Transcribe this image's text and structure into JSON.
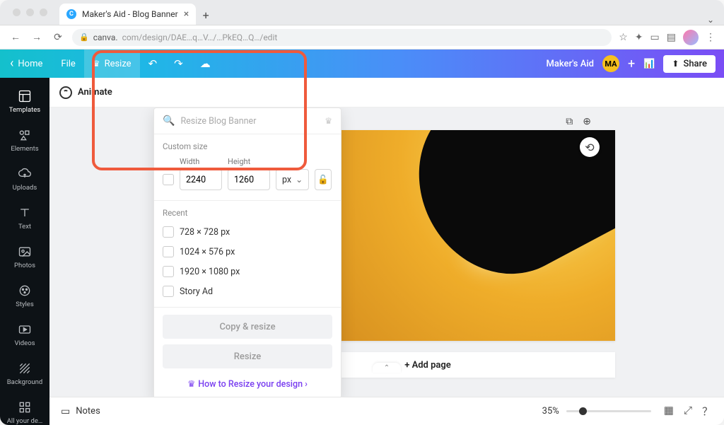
{
  "browser": {
    "tab_title": "Maker's Aid - Blog Banner",
    "url_host": "canva.",
    "url_path": "com/design/DAE…q…V…/…PkEQ…Q…/edit"
  },
  "menu": {
    "home": "Home",
    "file": "File",
    "resize": "Resize",
    "brand_text": "Maker's Aid",
    "brand_badge": "MA",
    "share": "Share"
  },
  "subbar": {
    "animate": "Animate"
  },
  "rail": {
    "items": [
      {
        "label": "Templates"
      },
      {
        "label": "Elements"
      },
      {
        "label": "Uploads"
      },
      {
        "label": "Text"
      },
      {
        "label": "Photos"
      },
      {
        "label": "Styles"
      },
      {
        "label": "Videos"
      },
      {
        "label": "Background"
      },
      {
        "label": "All your de…"
      }
    ]
  },
  "resize_panel": {
    "search_placeholder": "Resize Blog Banner",
    "custom_size": "Custom size",
    "width_label": "Width",
    "height_label": "Height",
    "width_value": "2240",
    "height_value": "1260",
    "unit": "px",
    "recent_header": "Recent",
    "recent": [
      "728 × 728 px",
      "1024 × 576 px",
      "1920 × 1080 px",
      "Story Ad"
    ],
    "copy_resize": "Copy & resize",
    "resize_btn": "Resize",
    "howto": "How to Resize your design"
  },
  "canvas": {
    "add_page": "+ Add page"
  },
  "bottom": {
    "notes": "Notes",
    "zoom": "35%"
  }
}
